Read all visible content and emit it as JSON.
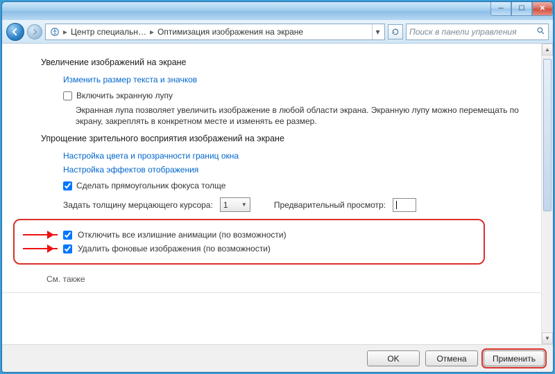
{
  "titlebar": {
    "minimize_glyph": "▁",
    "maximize_glyph": "▢",
    "close_glyph": "✕"
  },
  "nav": {
    "breadcrumb_seg1": "Центр специальн…",
    "breadcrumb_seg2": "Оптимизация изображения на экране",
    "search_placeholder": "Поиск в панели управления"
  },
  "sections": {
    "s1_title": "Увеличение изображений на экране",
    "s1_link": "Изменить размер текста и значков",
    "s1_chk1_label": "Включить экранную лупу",
    "s1_desc": "Экранная лупа позволяет увеличить изображение в любой области экрана. Экранную лупу можно перемещать по экрану, закреплять в конкретном месте и изменять ее размер.",
    "s2_title": "Упрощение зрительного восприятия изображений на экране",
    "s2_link1": "Настройка цвета и прозрачности границ окна",
    "s2_link2": "Настройка эффектов отображения",
    "s2_chk1_label": "Сделать прямоугольник фокуса толще",
    "cursor_label": "Задать толщину мерцающего курсора:",
    "cursor_value": "1",
    "preview_label": "Предварительный просмотр:",
    "hl_chk1": "Отключить все излишние анимации (по возможности)",
    "hl_chk2": "Удалить фоновые изображения (по возможности)",
    "see_also": "См. также"
  },
  "buttons": {
    "ok": "OK",
    "cancel": "Отмена",
    "apply": "Применить"
  }
}
